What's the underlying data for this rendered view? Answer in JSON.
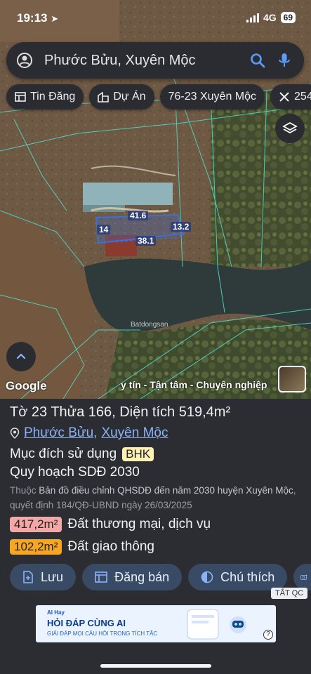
{
  "status_bar": {
    "time": "19:13",
    "network": "4G",
    "battery": "69"
  },
  "search": {
    "text": "Phước Bửu, Xuyên Mộc"
  },
  "chips": [
    {
      "label": "Tin Đăng",
      "icon": "table-icon"
    },
    {
      "label": "Dự Án",
      "icon": "building-icon"
    },
    {
      "label": "76-23 Xuyên Mộc",
      "icon": ""
    },
    {
      "label": "254",
      "icon": "crossed-tools-icon"
    }
  ],
  "map": {
    "google_logo": "Google",
    "marquee": "y tín - Tận tâm - Chuyên nghiệp",
    "dimensions": [
      "41.6",
      "14",
      "13.2",
      "38.1"
    ],
    "watermark": "Batdongsan"
  },
  "parcel": {
    "title_prefix": "Tờ ",
    "sheet": "23",
    "plot_prefix": " Thửa ",
    "plot": "166",
    "area_prefix": ", Diện tích ",
    "area": "519,4m²",
    "location_ward": "Phước Bửu",
    "location_district": "Xuyên Mộc",
    "purpose_label": "Mục đích sử dụng",
    "purpose_code": "BHK",
    "planning_label": "Quy hoạch SDĐ 2030",
    "source_prefix": "Thuộc",
    "source_main": "Bản đồ điều chỉnh QHSDĐ đến năm 2030 huyện Xuyên Mộc",
    "source_suffix": ", quyết định 184/QĐ-UBND ngày 26/03/2025",
    "land_uses": [
      {
        "area": "417,2m²",
        "label": "Đất thương mại, dịch vụ",
        "color": "#f4a7a7"
      },
      {
        "area": "102,2m²",
        "label": "Đất giao thông",
        "color": "#f6a623"
      }
    ]
  },
  "actions": [
    {
      "label": "Lưu",
      "icon": "save-icon"
    },
    {
      "label": "Đăng bán",
      "icon": "listing-icon"
    },
    {
      "label": "Chú thích",
      "icon": "legend-icon"
    },
    {
      "label": "",
      "icon": "camera-icon"
    }
  ],
  "ad": {
    "close_label": "TẮT QC",
    "brand": "AI Hay",
    "headline": "HỎI ĐÁP CÙNG AI",
    "subline": "GIẢI ĐÁP MỌI CÂU HỎI TRONG TÍCH TẮC",
    "help": "?"
  },
  "colors": {
    "accent": "#8ab4f8",
    "panel": "#2b2d33",
    "button": "#394a64"
  }
}
